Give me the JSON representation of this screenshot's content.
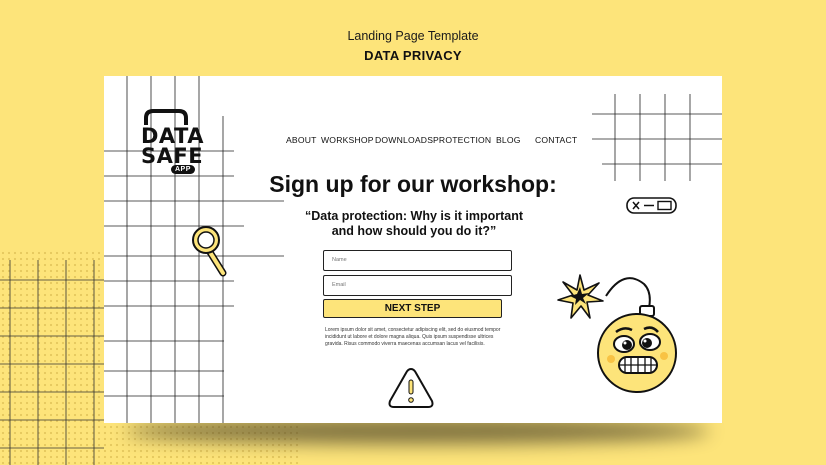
{
  "header": {
    "subtitle": "Landing Page Template",
    "title": "DATA PRIVACY"
  },
  "logo": {
    "line1": "DATA",
    "line2": "SAFE",
    "badge": "APP"
  },
  "nav": [
    "ABOUT",
    "WORKSHOP",
    "DOWNLOADS",
    "PROTECTION",
    "BLOG",
    "CONTACT"
  ],
  "hero": {
    "headline": "Sign up for our workshop:",
    "subheadline": "“Data protection: Why is it important and how should you do it?”"
  },
  "form": {
    "name_placeholder": "Name",
    "email_placeholder": "Email",
    "submit_label": "NEXT STEP",
    "disclaimer": "Lorem ipsum dolor sit amet, consectetur adipiscing elit, sed do eiusmod tempor incididunt ut labore et dolore magna aliqua. Quis ipsum suspendisse ultrices gravida. Risus commodo viverra maecenas accumsan lacus vel facilisis."
  },
  "colors": {
    "background": "#fde47a",
    "card": "#ffffff",
    "accent": "#fde47a",
    "ink": "#111111"
  },
  "icons": [
    "magnifier-icon",
    "warning-icon",
    "password-field-icon",
    "bomb-illustration",
    "spark-icon"
  ]
}
